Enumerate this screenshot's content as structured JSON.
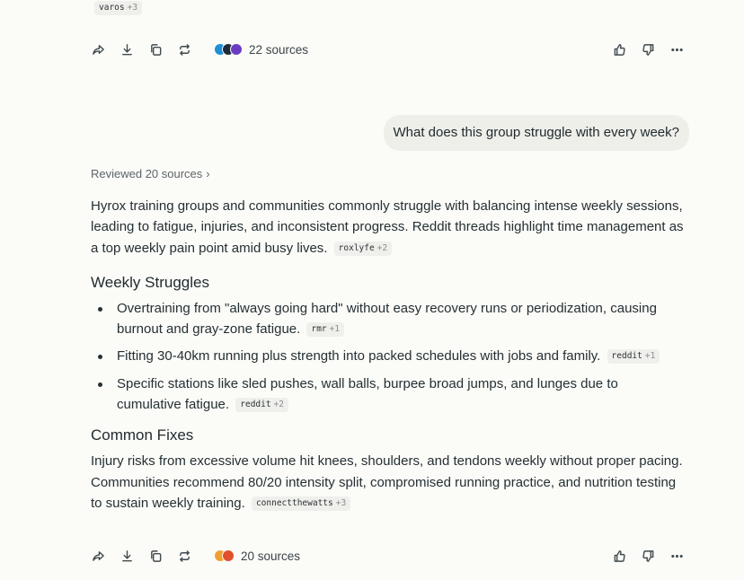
{
  "top": {
    "chip": {
      "label": "varos",
      "plus": "+3"
    },
    "action_bar": {
      "sources_label": "22 sources",
      "favicon_colors": [
        "#1f8fd6",
        "#1d2a3a",
        "#6a3cc2"
      ]
    }
  },
  "question": "What does this group struggle with every week?",
  "reviewed": "Reviewed 20 sources",
  "answer": {
    "intro": "Hyrox training groups and communities commonly struggle with balancing intense weekly sessions, leading to fatigue, injuries, and inconsistent progress. Reddit threads highlight time management as a top weekly pain point amid busy lives.",
    "intro_chip": {
      "label": "roxlyfe",
      "plus": "+2"
    },
    "heading_struggles": "Weekly Struggles",
    "struggles": [
      {
        "text": "Overtraining from \"always going hard\" without easy recovery runs or periodization, causing burnout and gray-zone fatigue.",
        "chip": "rmr",
        "plus": "+1"
      },
      {
        "text": "Fitting 30-40km running plus strength into packed schedules with jobs and family.",
        "chip": "reddit",
        "plus": "+1"
      },
      {
        "text": "Specific stations like sled pushes, wall balls, burpee broad jumps, and lunges due to cumulative fatigue.",
        "chip": "reddit",
        "plus": "+2"
      }
    ],
    "heading_fixes": "Common Fixes",
    "fixes": "Injury risks from excessive volume hit knees, shoulders, and tendons weekly without proper pacing. Communities recommend 80/20 intensity split, compromised running practice, and nutrition testing to sustain weekly training.",
    "fixes_chip": {
      "label": "connectthewatts",
      "plus": "+3"
    }
  },
  "bottom": {
    "action_bar": {
      "sources_label": "20 sources",
      "favicon_colors": [
        "#f0a030",
        "#e0502a"
      ]
    }
  },
  "icons": [
    "share-icon",
    "download-icon",
    "copy-icon",
    "rewrite-icon",
    "thumbs-up-icon",
    "thumbs-down-icon",
    "more-icon"
  ]
}
